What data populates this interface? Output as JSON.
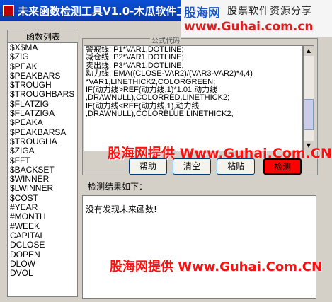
{
  "window": {
    "title": "未来函数检测工具V1.0-木瓜软件工作"
  },
  "brand": {
    "logo": "股海网",
    "slogan": "股票软件资源分享",
    "url": "www.Guhai.com.cn"
  },
  "function_list": {
    "header": "函数列表",
    "items": [
      "$X$MA",
      "$ZIG",
      "$PEAK",
      "$PEAKBARS",
      "$TROUGH",
      "$TROUGHBARS",
      "$FLATZIG",
      "$FLATZIGA",
      "$PEAKA",
      "$PEAKBARSA",
      "$TROUGHA",
      "$ZIGA",
      "$FFT",
      "$BACKSET",
      "$WINNER",
      "$LWINNER",
      "$COST",
      "#YEAR",
      "#MONTH",
      "#WEEK",
      "CAPITAL",
      "DCLOSE",
      "DOPEN",
      "DLOW",
      "DVOL"
    ]
  },
  "editor": {
    "caption": "公式代码",
    "lines": [
      "警戒线: P1*VAR1,DOTLINE;",
      "减仓线: P2*VAR1,DOTLINE;",
      "卖出线: P3*VAR1,DOTLINE;",
      "动力线: EMA((CLOSE-VAR2)/(VAR3-VAR2)*4,4)",
      "*VAR1,LINETHICK2,COLORGREEN;",
      "IF(动力线>REF(动力线,1)*1.01,动力线",
      ",DRAWNULL),COLORRED,LINETHICK2;",
      "IF(动力线<REF(动力线,1),动力线",
      ",DRAWNULL),COLORBLUE,LINETHICK2;"
    ]
  },
  "buttons": {
    "help": "帮助",
    "clear": "清空",
    "paste": "粘贴",
    "run": "检测"
  },
  "watermark": "股海网提供 Www.Guhai.Com.CN",
  "result": {
    "label": "检测结果如下：",
    "text": "没有发现未来函数!"
  },
  "colors": {
    "title_bar": "#0a4fd6",
    "run_button": "#ff0000",
    "watermark": "#ff1010"
  }
}
